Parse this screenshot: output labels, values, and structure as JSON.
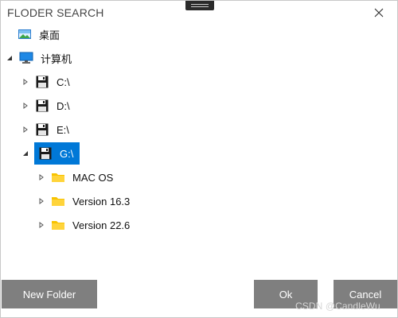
{
  "window": {
    "title": "FLODER SEARCH"
  },
  "tree": {
    "desktop": "桌面",
    "computer": "计算机",
    "drives": [
      {
        "label": "C:\\"
      },
      {
        "label": "D:\\"
      },
      {
        "label": "E:\\"
      },
      {
        "label": "G:\\"
      }
    ],
    "folders": [
      {
        "label": "MAC OS"
      },
      {
        "label": "Version 16.3"
      },
      {
        "label": "Version 22.6"
      }
    ],
    "selected": "G:\\"
  },
  "buttons": {
    "new_folder": "New Folder",
    "ok": "Ok",
    "cancel": "Cancel"
  },
  "watermark": "CSDN @CandleWu",
  "colors": {
    "selection": "#0078d7",
    "button": "#7f7f7f",
    "folder": "#f8c300"
  },
  "icons": {
    "desktop": "desktop-image-icon",
    "computer": "monitor-icon",
    "drive": "floppy-disk-icon",
    "folder": "folder-icon",
    "close": "close-icon",
    "grip": "drag-grip-icon"
  }
}
